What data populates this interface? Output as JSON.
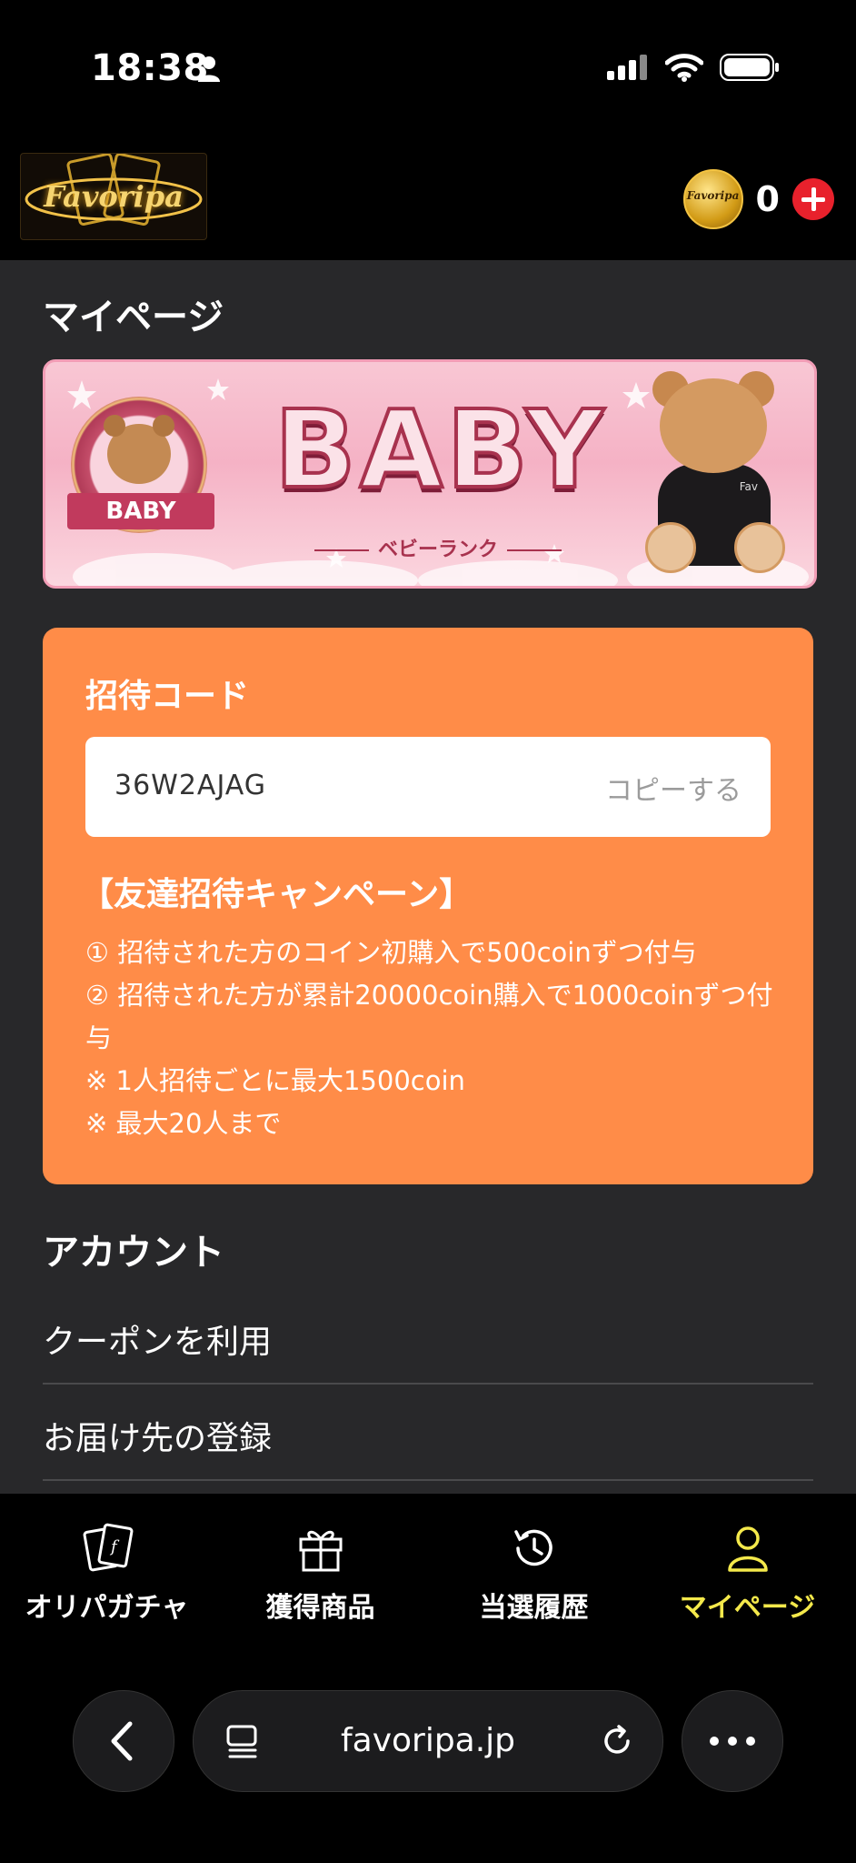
{
  "status_bar": {
    "time": "18:38"
  },
  "header": {
    "logo_text": "Favoripa",
    "coin_icon_text": "Favoripa",
    "coin_balance": "0"
  },
  "main": {
    "page_title": "マイページ",
    "rank_banner": {
      "title": "BABY",
      "subtitle": "ベビーランク",
      "badge_label": "BABY",
      "bear_text": "Fav"
    },
    "invite": {
      "title": "招待コード",
      "code": "36W2AJAG",
      "copy_label": "コピーする",
      "campaign_title": "【友達招待キャンペーン】",
      "lines": [
        "① 招待された方のコイン初購入で500coinずつ付与",
        "② 招待された方が累計20000coin購入で1000coinずつ付与",
        "※ 1人招待ごとに最大1500coin",
        "※ 最大20人まで"
      ]
    },
    "account": {
      "title": "アカウント",
      "items": [
        {
          "label": "クーポンを利用"
        },
        {
          "label": "お届け先の登録"
        }
      ]
    }
  },
  "bottom_nav": {
    "items": [
      {
        "label": "オリパガチャ",
        "icon": "card-icon"
      },
      {
        "label": "獲得商品",
        "icon": "gift-icon"
      },
      {
        "label": "当選履歴",
        "icon": "history-icon"
      },
      {
        "label": "マイページ",
        "icon": "user-icon",
        "active": true
      }
    ],
    "active_color": "#f4e94b"
  },
  "browser": {
    "url": "favoripa.jp"
  },
  "colors": {
    "invite_card": "#ff8c48",
    "main_bg": "#28282a",
    "add_button": "#e8212c"
  }
}
